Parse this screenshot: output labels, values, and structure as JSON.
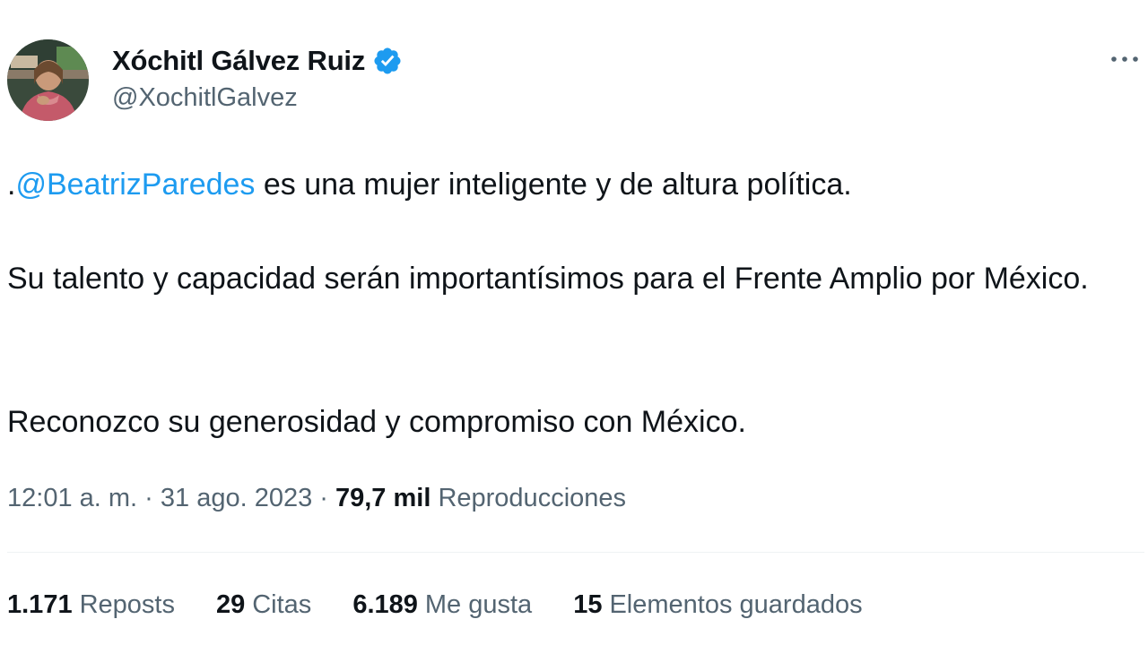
{
  "author": {
    "display_name": "Xóchitl Gálvez Ruiz",
    "handle": "@XochitlGalvez",
    "verified": true,
    "avatar_icon": "profile-photo",
    "verified_icon": "verified-badge-icon"
  },
  "menu": {
    "more_icon": "more-options-icon"
  },
  "tweet": {
    "prefix": ".",
    "mention": "@BeatrizParedes",
    "line1_rest": " es una mujer inteligente y de altura política.",
    "para2": "Su talento y capacidad serán importantísimos para el Frente Amplio por México.",
    "para3": "Reconozco su generosidad y compromiso con México."
  },
  "meta": {
    "time": "12:01 a. m.",
    "separator": " · ",
    "date": "31 ago. 2023",
    "views_count": "79,7 mil",
    "views_label": " Reproducciones"
  },
  "stats": [
    {
      "count": "1.171",
      "label": "Reposts"
    },
    {
      "count": "29",
      "label": "Citas"
    },
    {
      "count": "6.189",
      "label": "Me gusta"
    },
    {
      "count": "15",
      "label": "Elementos guardados"
    }
  ],
  "colors": {
    "text": "#0f1419",
    "secondary": "#536471",
    "link": "#1d9bf0",
    "verified": "#1d9bf0",
    "divider": "#eff3f4"
  }
}
